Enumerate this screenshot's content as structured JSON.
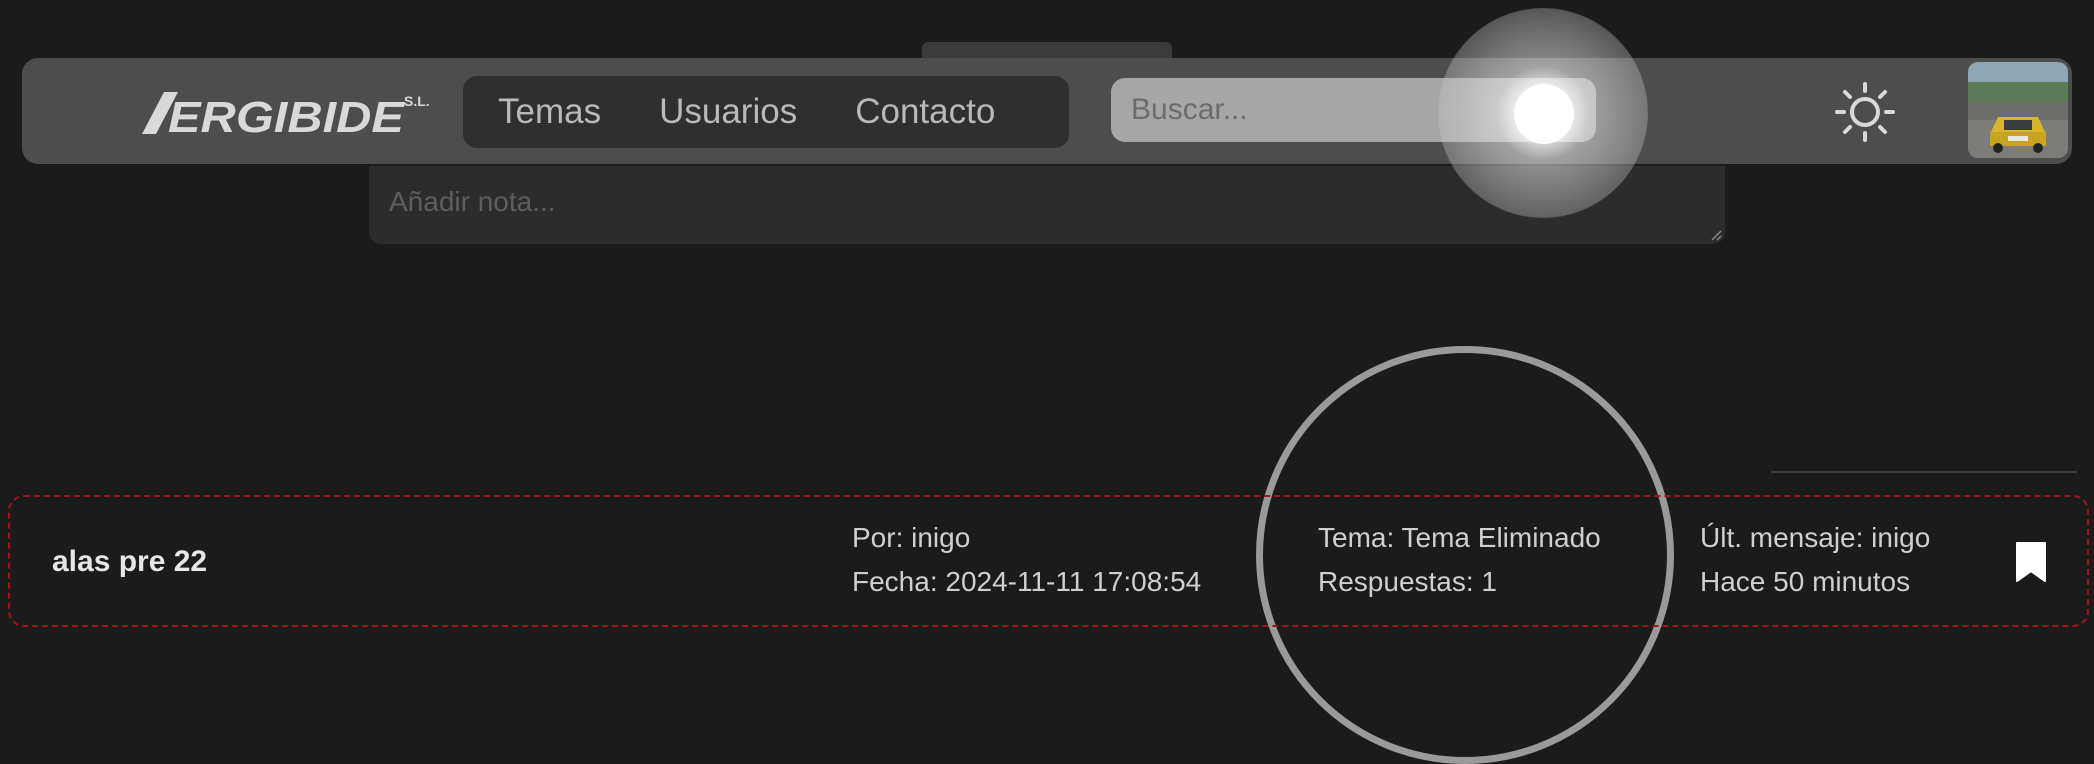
{
  "navbar": {
    "logo_text": "ERGIBIDE",
    "logo_suffix": "S.L.",
    "links": [
      {
        "label": "Temas"
      },
      {
        "label": "Usuarios"
      },
      {
        "label": "Contacto"
      }
    ],
    "search": {
      "placeholder": "Buscar...",
      "value": ""
    },
    "theme_icon": "sun-icon",
    "avatar_icon": "user-avatar-photo"
  },
  "note": {
    "placeholder": "Añadir nota...",
    "value": ""
  },
  "topic": {
    "title": "alas pre 22",
    "author_line": "Por: inigo",
    "date_line": "Fecha: 2024-11-11 17:08:54",
    "topic_line": "Tema: Tema Eliminado",
    "replies_line": "Respuestas: 1",
    "last_message_line": "Últ. mensaje: inigo",
    "last_time_line": "Hace 50 minutos",
    "bookmark_icon": "bookmark-icon"
  },
  "colors": {
    "background": "#1b1b1b",
    "navbar": "#4d4d4d",
    "nav_links_bg": "#2f2f2f",
    "search_bg": "#a6a6a6",
    "row_border": "#a01515"
  }
}
